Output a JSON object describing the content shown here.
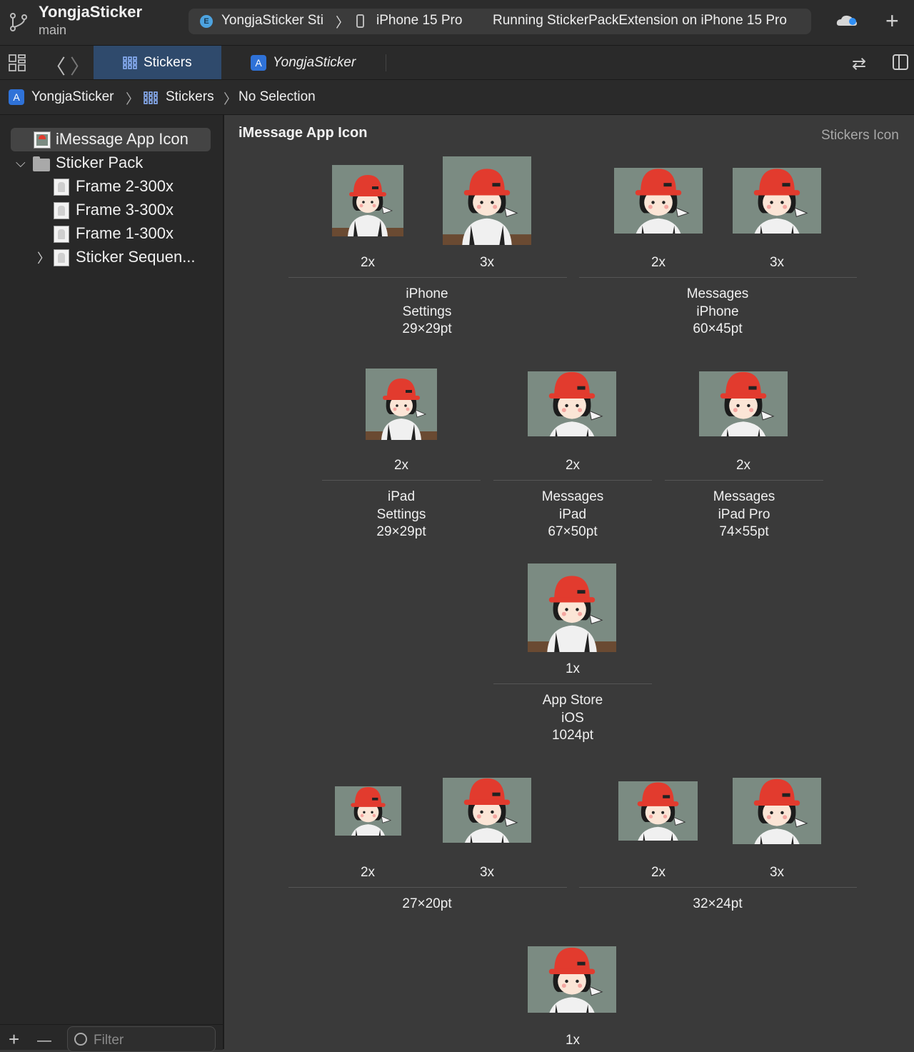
{
  "toolbar": {
    "project_name": "YongjaSticker",
    "branch": "main",
    "scheme_badge": "E",
    "scheme_name": "YongjaSticker Sti",
    "scheme_chevron": "〉",
    "device": "iPhone 15 Pro",
    "status": "Running StickerPackExtension on iPhone 15 Pro",
    "add_symbol": "+"
  },
  "tabs": {
    "back": "〈",
    "forward": "〉",
    "active_tab": "Stickers",
    "second_tab": "YongjaSticker",
    "swap_symbol": "⇄"
  },
  "breadcrumb": {
    "items": [
      "YongjaSticker",
      "Stickers",
      "No Selection"
    ],
    "separator": "〉"
  },
  "sidebar": {
    "items": [
      {
        "label": "iMessage App Icon"
      },
      {
        "label": "Sticker Pack"
      },
      {
        "label": "Frame 2-300x"
      },
      {
        "label": "Frame 3-300x"
      },
      {
        "label": "Frame 1-300x"
      },
      {
        "label": "Sticker Sequen..."
      }
    ],
    "expand_open": "⌵",
    "expand_closed": "〉",
    "footer_add": "+",
    "footer_remove": "—",
    "filter_placeholder": "Filter"
  },
  "main": {
    "title": "iMessage App Icon",
    "subtitle": "Stickers Icon",
    "groups": [
      {
        "label": [
          "iPhone",
          "Settings",
          "29×29pt"
        ],
        "scales": [
          "2x",
          "3x"
        ]
      },
      {
        "label": [
          "Messages",
          "iPhone",
          "60×45pt"
        ],
        "scales": [
          "2x",
          "3x"
        ]
      },
      {
        "label": [
          "iPad",
          "Settings",
          "29×29pt"
        ],
        "scales": [
          "2x"
        ]
      },
      {
        "label": [
          "Messages",
          "iPad",
          "67×50pt"
        ],
        "scales": [
          "2x"
        ]
      },
      {
        "label": [
          "Messages",
          "iPad Pro",
          "74×55pt"
        ],
        "scales": [
          "2x"
        ]
      },
      {
        "label": [
          "App Store",
          "iOS",
          "1024pt"
        ],
        "scales": [
          "1x"
        ]
      },
      {
        "label": [
          "27×20pt"
        ],
        "scales": [
          "2x",
          "3x"
        ]
      },
      {
        "label": [
          "32×24pt"
        ],
        "scales": [
          "2x",
          "3x"
        ]
      },
      {
        "label": [],
        "scales": [
          "1x"
        ]
      }
    ]
  },
  "colors": {
    "accent_tab": "#2f4a6c",
    "hat_red": "#e23b2e",
    "icon_bg": "#7b8b82"
  }
}
